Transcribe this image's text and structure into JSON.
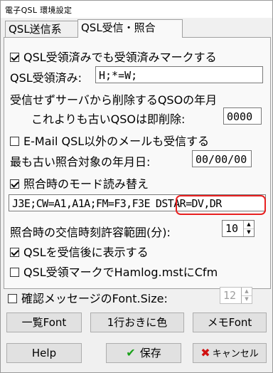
{
  "window": {
    "title": "電子QSL 環境設定"
  },
  "tabs": [
    {
      "label": "QSL送信系",
      "active": false
    },
    {
      "label": "QSL受信・照合",
      "active": true
    }
  ],
  "options": {
    "mark_received": {
      "label": "QSL受領済みでも受領済みマークする",
      "checked": true
    },
    "received_label": "QSL受領済み:",
    "received_value": "H;*=W;",
    "delete_year_label": "受信せずサーバから削除するQSOの年月",
    "delete_older_label": "これよりも古いQSOは即削除:",
    "delete_older_value": "0000",
    "email_other": {
      "label": "E-Mail QSL以外のメールも受信する",
      "checked": false
    },
    "oldest_label": "最も古い照合対象の年月日:",
    "oldest_value": "00/00/00",
    "mode_replace": {
      "label": "照合時のモード読み替え",
      "checked": true
    },
    "mode_map_value": "J3E;CW=A1,A1A;FM=F3,F3E",
    "mode_map_highlight": "DSTAR=DV,DR",
    "tolerance_label": "照合時の交信時刻許容範囲(分):",
    "tolerance_value": "10",
    "show_after": {
      "label": "QSLを受信後に表示する",
      "checked": true
    },
    "hamlog_cfm": {
      "label": "QSL受領マークでHamlog.mstにCfm",
      "checked": false
    }
  },
  "footer": {
    "confirm_font": {
      "label": "確認メッセージのFont.Size:",
      "checked": false,
      "value": "12"
    },
    "list_font_button": "一覧Font",
    "alt_color_button": "1行おきに色",
    "memo_font_button": "メモFont",
    "help_button": "Help",
    "save_button": "保存",
    "cancel_button": "キャンセル"
  },
  "colors": {
    "highlight_border": "#e82020",
    "save_icon": "#1aa11a",
    "cancel_icon": "#d01010"
  },
  "icons": {
    "save": "checkmark-icon",
    "cancel": "x-icon"
  }
}
